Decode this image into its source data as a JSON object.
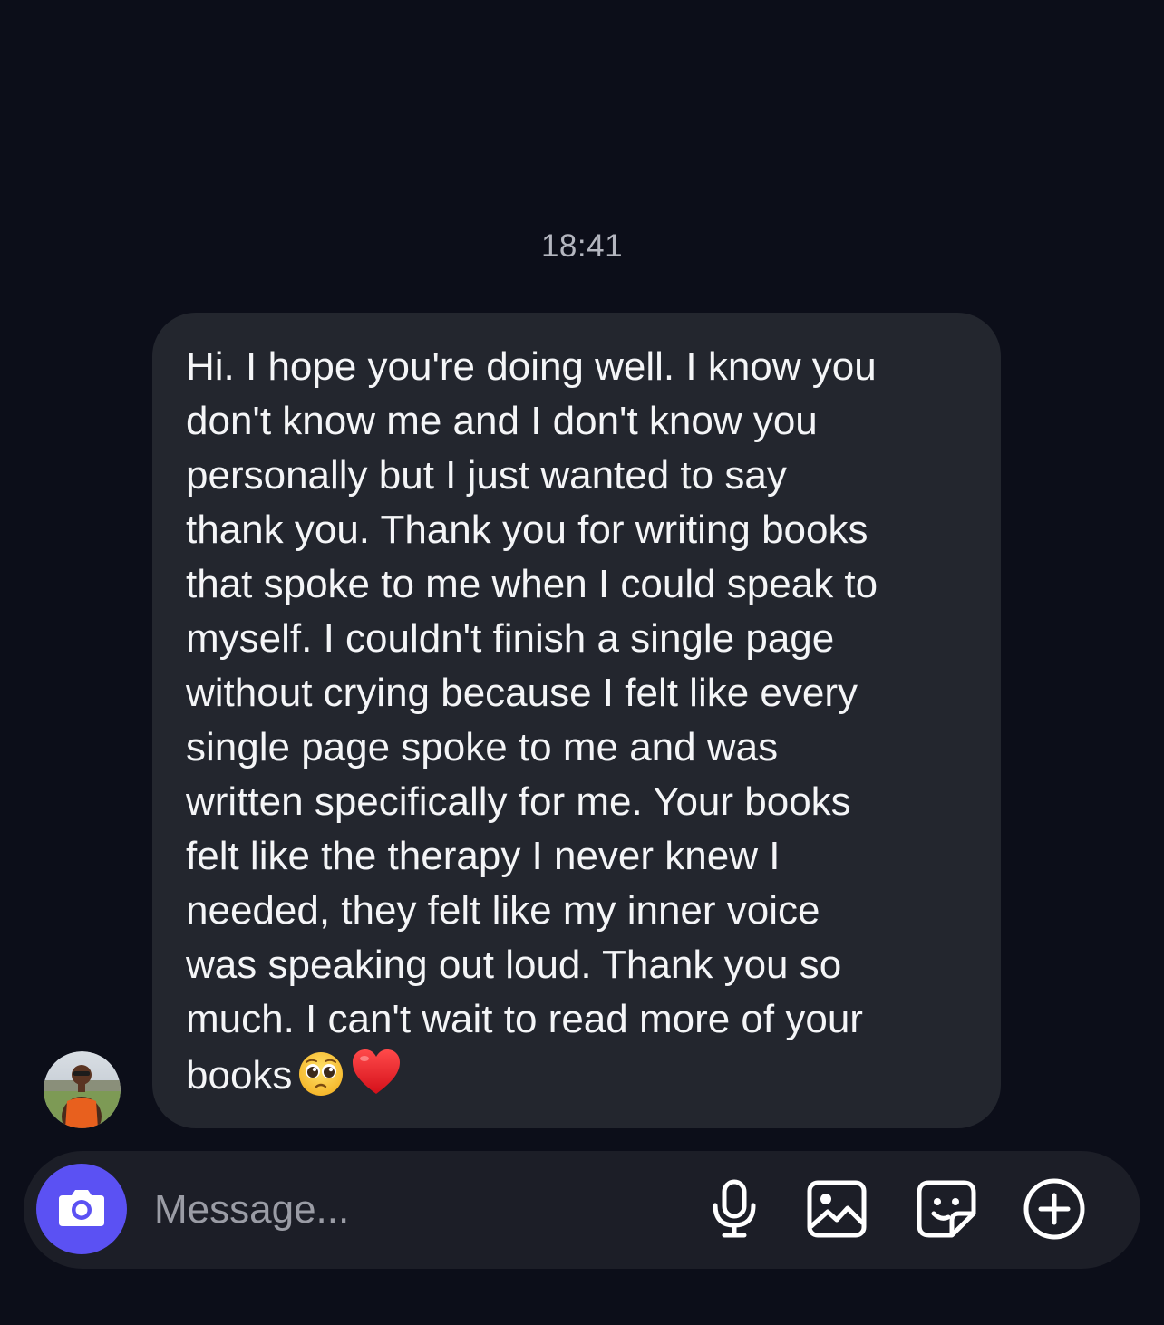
{
  "thread": {
    "timestamp": "18:41"
  },
  "message": {
    "lines": [
      "Hi. I hope you're doing well. I know you",
      "don't know me and I don't know you",
      "personally but I just wanted to say",
      "thank you. Thank you for writing books",
      "that spoke to me when I could speak to",
      "myself. I couldn't finish a single page",
      "without crying because I felt like every",
      "single page spoke to me and was",
      "written specifically for me. Your books",
      "felt like the therapy I never knew I",
      "needed, they felt like my inner voice",
      "was speaking out loud. Thank you so",
      "much. I can't wait to read more of your",
      "books"
    ],
    "trailing_emojis": [
      "pleading-face-emoji",
      "red-heart-emoji"
    ]
  },
  "composer": {
    "placeholder": "Message...",
    "camera_icon": "camera-icon",
    "tools": [
      "microphone-icon",
      "gallery-icon",
      "sticker-icon",
      "add-icon"
    ]
  },
  "colors": {
    "background": "#0c0e19",
    "bubble": "#23262e",
    "composer": "#1c1e27",
    "camera_button": "#5b51f3",
    "text": "#f4f5f7",
    "muted_text": "#b4b6bf"
  }
}
